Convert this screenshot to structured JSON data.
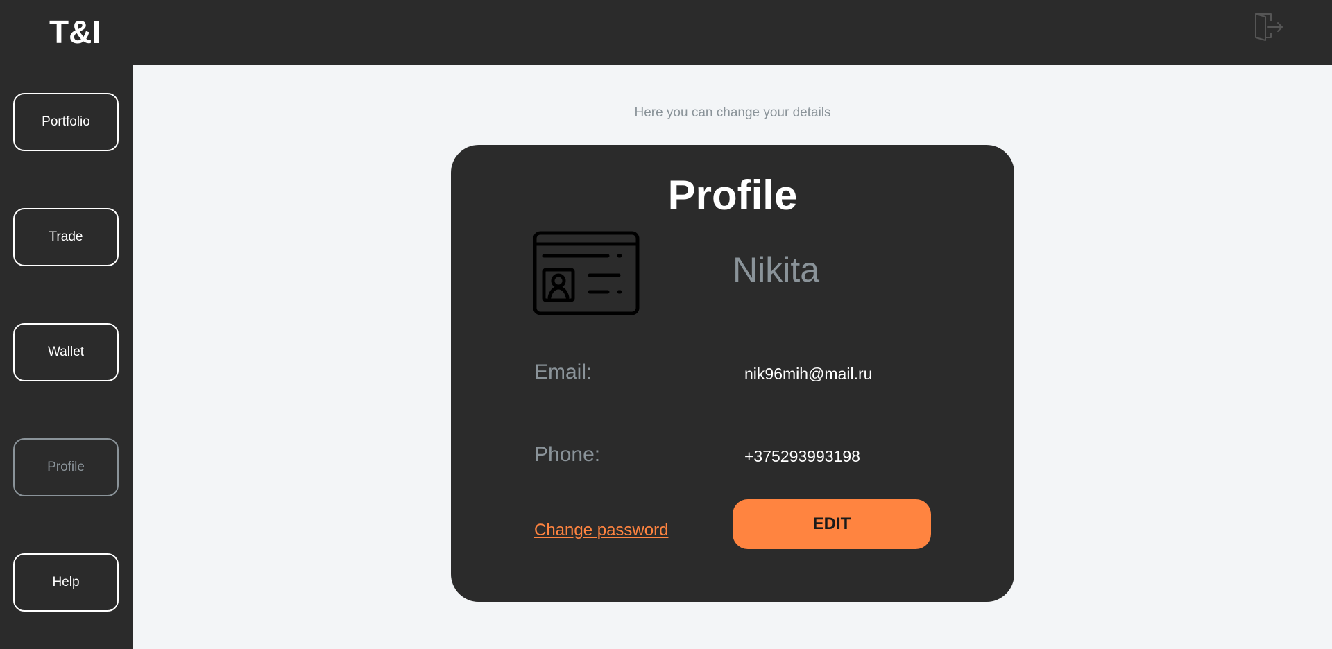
{
  "header": {
    "logo": "T&I",
    "logout_icon": "logout-door-icon"
  },
  "sidebar": {
    "items": [
      {
        "label": "Portfolio",
        "active": false
      },
      {
        "label": "Trade",
        "active": false
      },
      {
        "label": "Wallet",
        "active": false
      },
      {
        "label": "Profile",
        "active": true
      },
      {
        "label": "Help",
        "active": false
      }
    ]
  },
  "main": {
    "subtitle": "Here you can change your details"
  },
  "profile": {
    "title": "Profile",
    "icon": "id-card-icon",
    "name": "Nikita",
    "email_label": "Email:",
    "email_value": "nik96mih@mail.ru",
    "phone_label": "Phone:",
    "phone_value": "+375293993198",
    "change_password": "Change password",
    "edit_label": "EDIT"
  },
  "colors": {
    "dark_bg": "#2b2b2b",
    "page_bg": "#f3f5f7",
    "accent": "#ff8440",
    "muted": "#8a9399",
    "white": "#ffffff"
  }
}
